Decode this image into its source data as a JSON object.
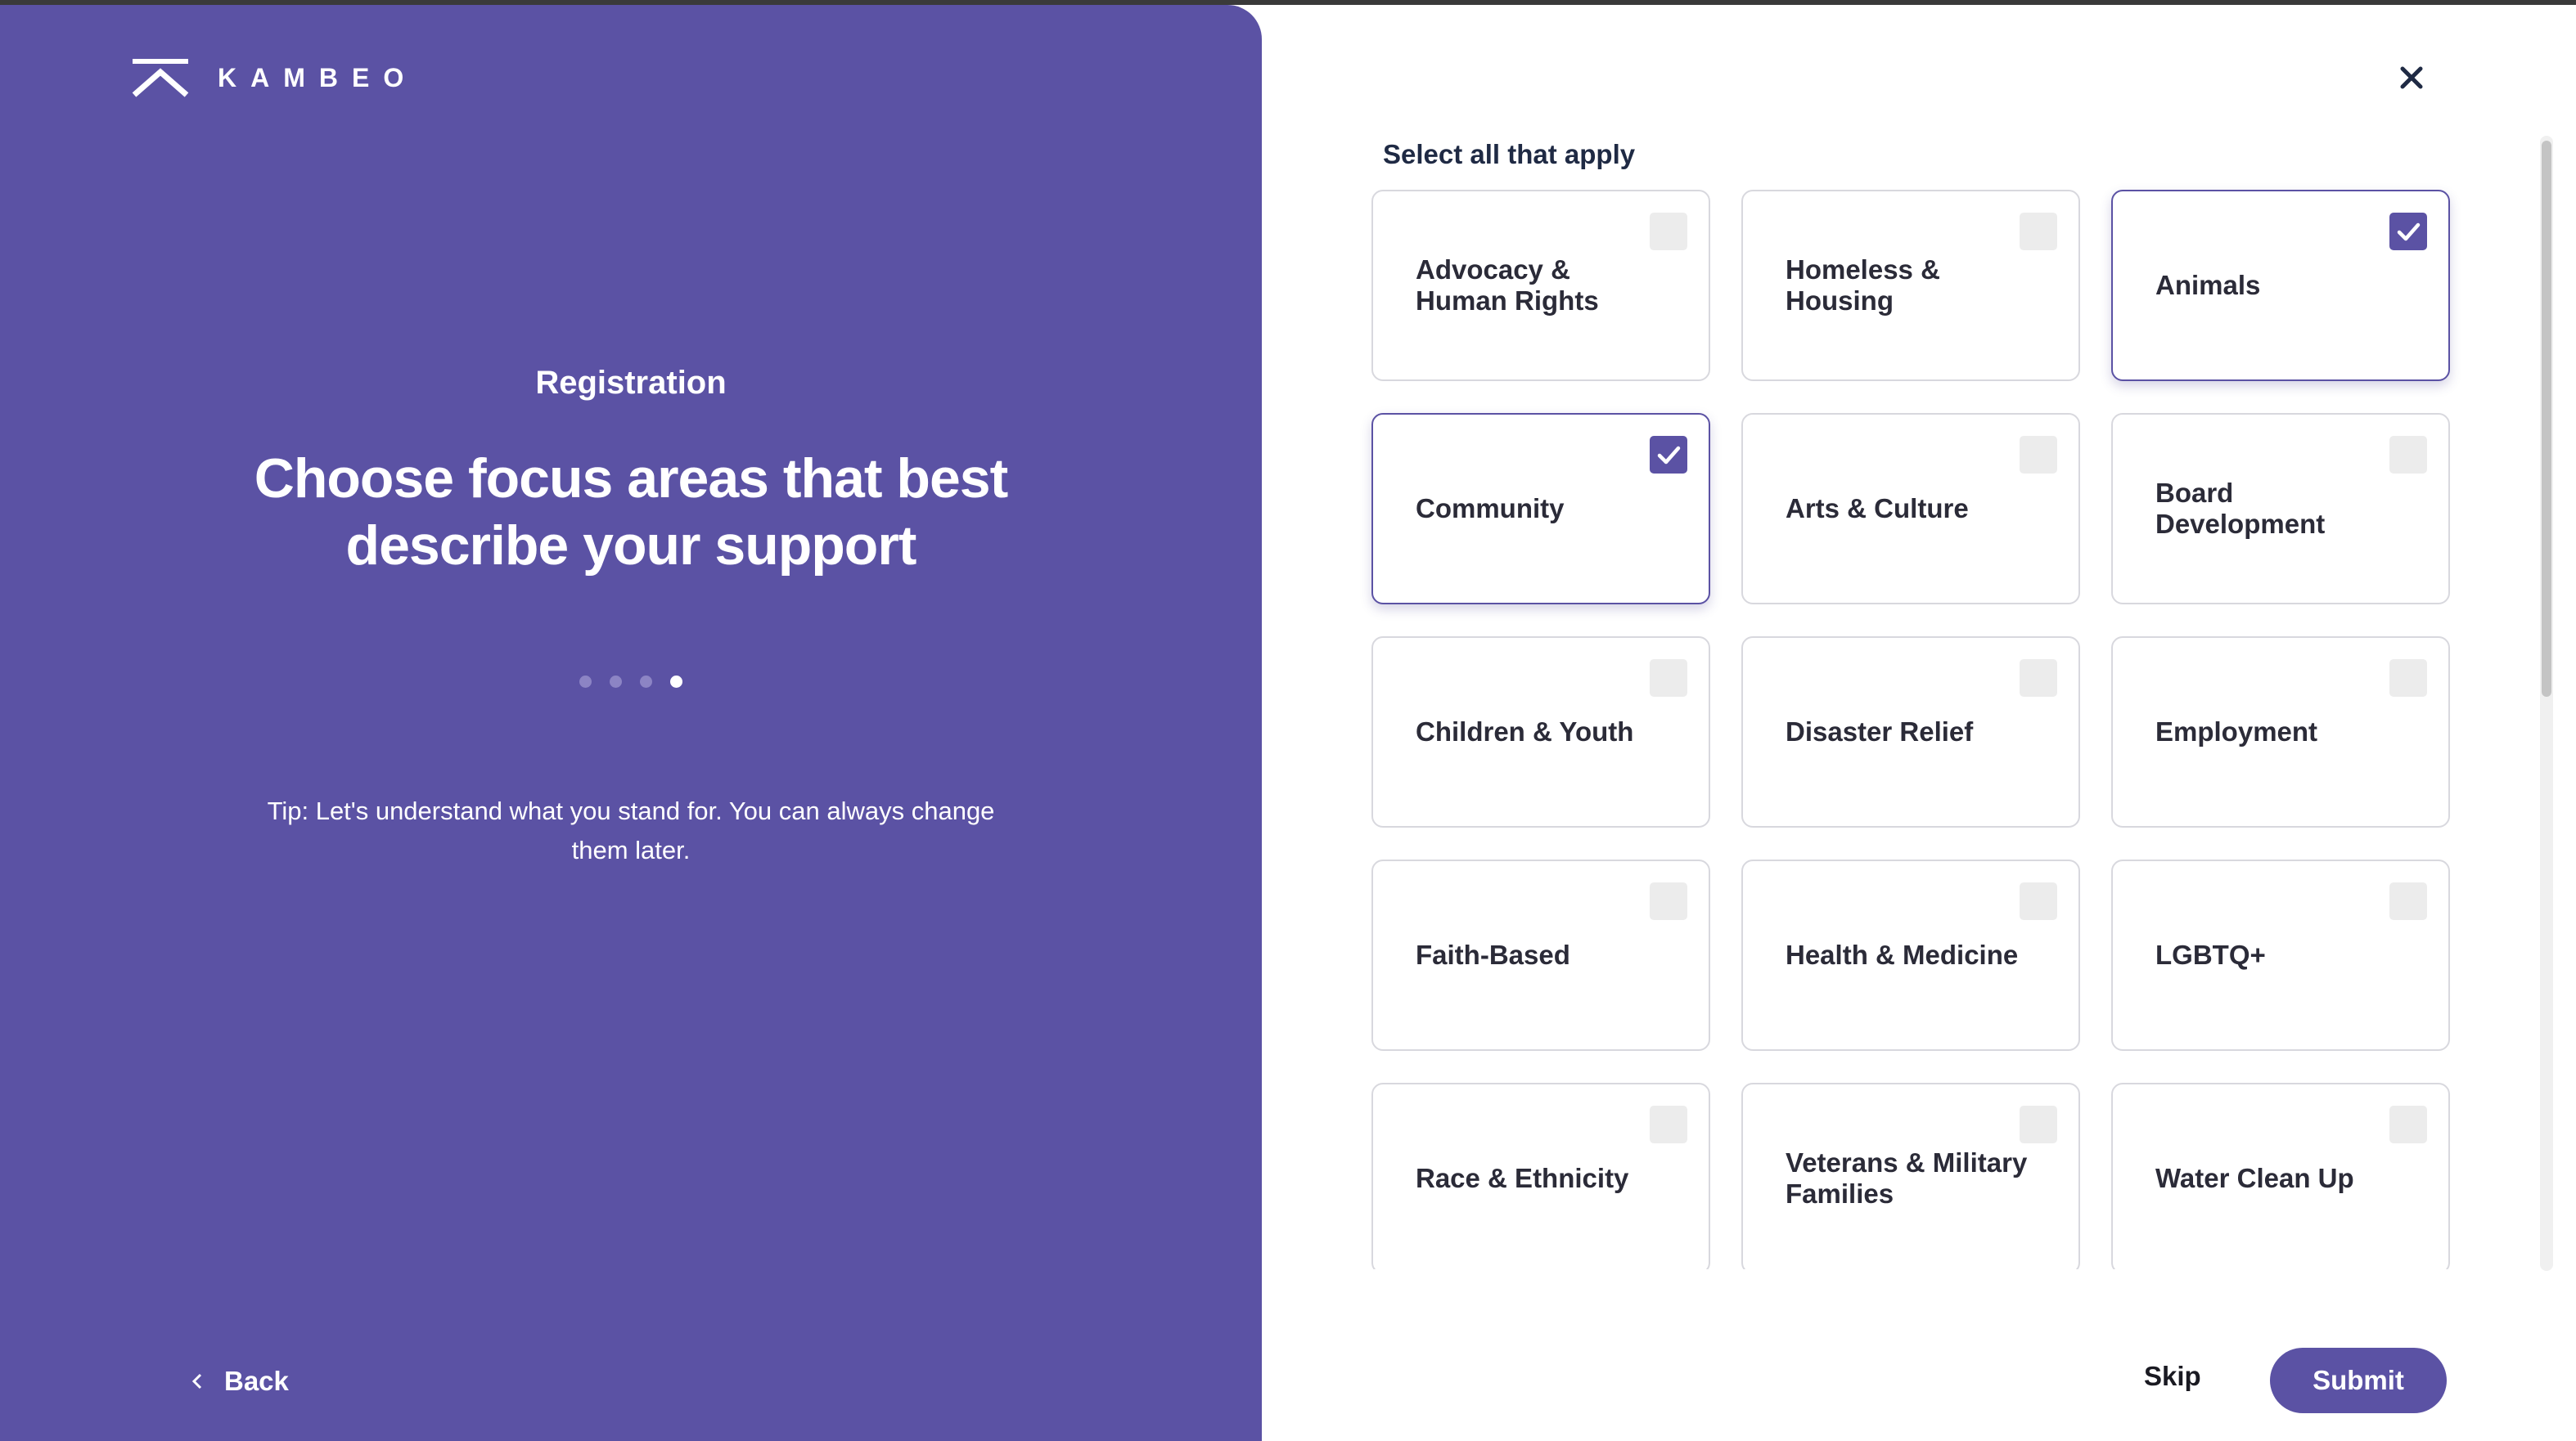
{
  "brand": {
    "name": "KAMBEO",
    "logo_icon": "kambeo-chevron-logo"
  },
  "left": {
    "section_label": "Registration",
    "headline": "Choose focus areas that best describe your support",
    "steps": {
      "total": 4,
      "current": 4
    },
    "tip": "Tip: Let's understand what you stand for. You can always change them later.",
    "back_label": "Back",
    "back_icon": "chevron-left-icon"
  },
  "right": {
    "close_icon": "close-icon",
    "instruction": "Select all that apply",
    "options": [
      {
        "label": "Advocacy & Human Rights",
        "selected": false
      },
      {
        "label": "Homeless & Housing",
        "selected": false
      },
      {
        "label": "Animals",
        "selected": true
      },
      {
        "label": "Community",
        "selected": true
      },
      {
        "label": "Arts & Culture",
        "selected": false
      },
      {
        "label": "Board Development",
        "selected": false
      },
      {
        "label": "Children & Youth",
        "selected": false
      },
      {
        "label": "Disaster Relief",
        "selected": false
      },
      {
        "label": "Employment",
        "selected": false
      },
      {
        "label": "Faith-Based",
        "selected": false
      },
      {
        "label": "Health & Medicine",
        "selected": false
      },
      {
        "label": "LGBTQ+",
        "selected": false
      },
      {
        "label": "Race & Ethnicity",
        "selected": false
      },
      {
        "label": "Veterans & Military Families",
        "selected": false
      },
      {
        "label": "Water Clean Up",
        "selected": false
      }
    ],
    "skip_label": "Skip",
    "submit_label": "Submit"
  },
  "colors": {
    "brand_purple": "#5b52a4",
    "checkbox_empty": "#ececec",
    "card_border": "#d8d8de"
  }
}
